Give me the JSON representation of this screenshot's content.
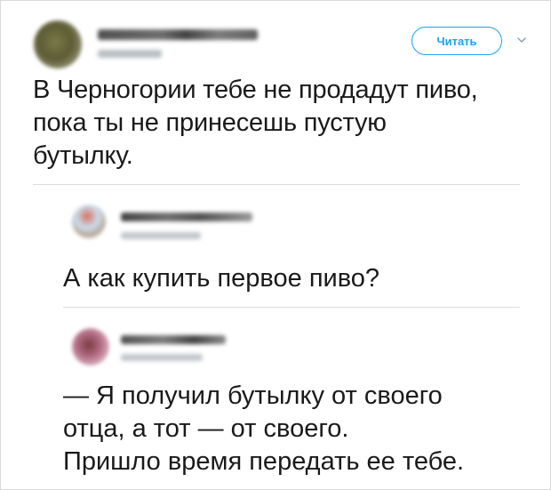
{
  "main_tweet": {
    "follow_label": "Читать",
    "text_lines": [
      "В Черногории тебе не продадут пиво,",
      "пока ты не принесешь пустую",
      "бутылку."
    ]
  },
  "replies": [
    {
      "text_lines": [
        "А как купить первое пиво?"
      ]
    },
    {
      "text_lines": [
        "— Я получил бутылку от своего",
        "отца, а тот — от своего.",
        "Пришло время передать ее тебе."
      ]
    }
  ],
  "colors": {
    "accent": "#1da1f2",
    "text": "#1a1a1a",
    "divider": "#d9dde0"
  },
  "icons": {
    "menu": "chevron-down-icon"
  }
}
